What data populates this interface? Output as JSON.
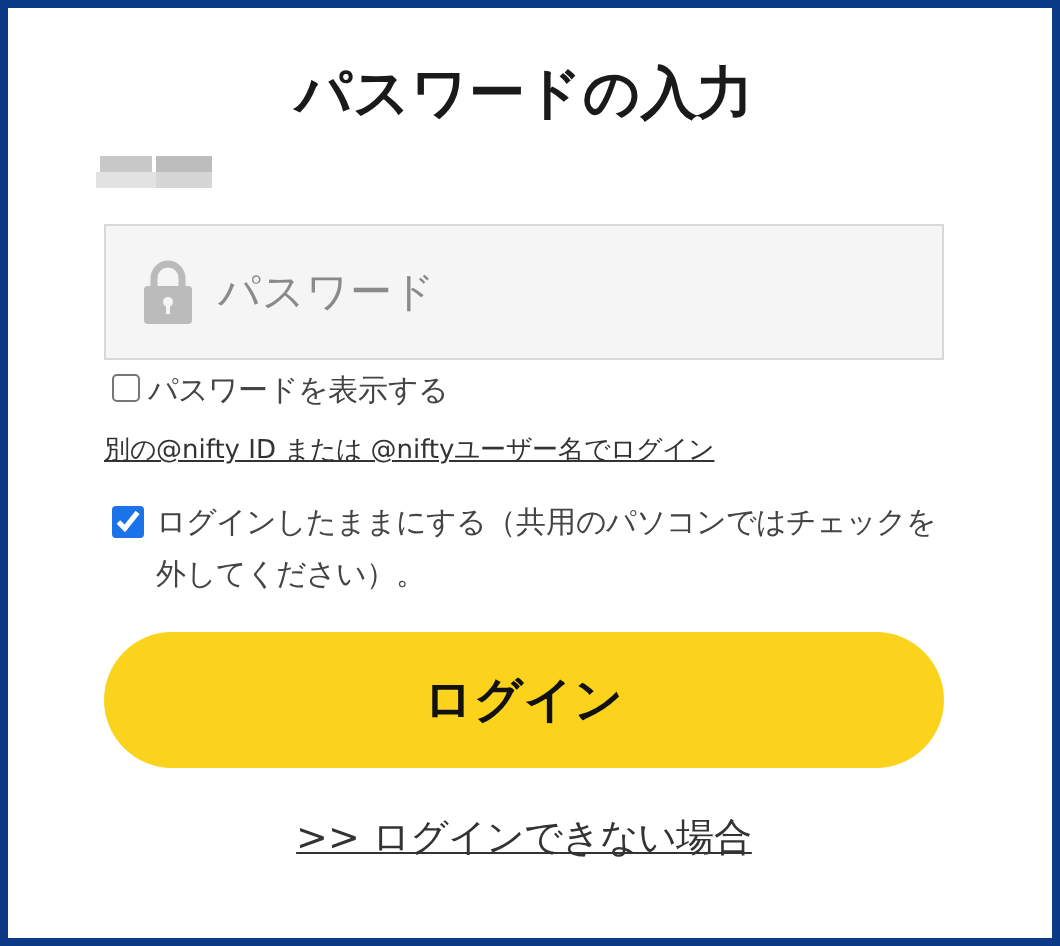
{
  "title": "パスワードの入力",
  "password_field": {
    "placeholder": "パスワード"
  },
  "show_password": {
    "label": "パスワードを表示する",
    "checked": false
  },
  "alt_login_link": "別の@nifty ID または @niftyユーザー名でログイン",
  "stay_logged_in": {
    "label": "ログインしたままにする（共用のパソコンではチェックを外してください）。",
    "checked": true
  },
  "login_button": "ログイン",
  "help_link": ">> ログインできない場合"
}
